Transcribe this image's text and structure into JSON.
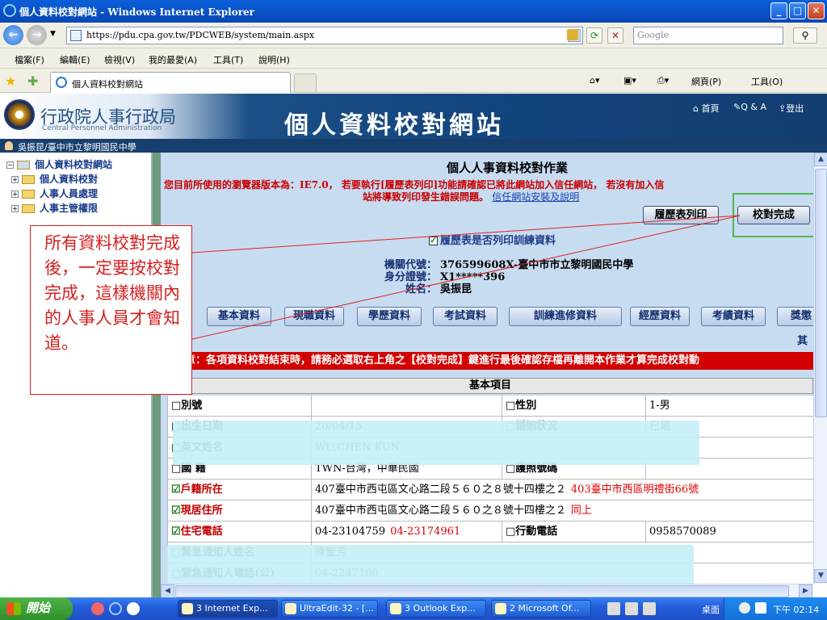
{
  "window": {
    "title": "個人資料校對網站 - Windows Internet Explorer",
    "min": "_",
    "max": "□",
    "close": "✕"
  },
  "address": {
    "url": "https://pdu.cpa.gov.tw/PDCWEB/system/main.aspx",
    "search_placeholder": "Google"
  },
  "menu": [
    "檔案(F)",
    "編輯(E)",
    "檢視(V)",
    "我的最愛(A)",
    "工具(T)",
    "說明(H)"
  ],
  "tab": {
    "label": "個人資料校對網站"
  },
  "commandbar": {
    "page": "網頁(P)",
    "tools": "工具(O)"
  },
  "site": {
    "org_name": "行政院人事行政局",
    "org_name_en": "Central Personnel Administration",
    "title": "個人資料校對網站",
    "links": [
      "首頁",
      "Q & A",
      "登出"
    ],
    "user": "吳振昆/臺中市立黎明國民中學"
  },
  "tree": [
    {
      "label": "個人資料校對網站",
      "sign": "−"
    },
    {
      "label": "個人資料校對",
      "sign": "+"
    },
    {
      "label": "人事人員處理",
      "sign": "+"
    },
    {
      "label": "人事主管權限",
      "sign": "+"
    }
  ],
  "main": {
    "title": "個人人事資料校對作業",
    "warning_line1": "您目前所使用的瀏覽器版本為：IE7.0， 若要執行[履歷表列印]功能請確認已將此網站加入信任網站， 若沒有加入信",
    "warning_line2": "站將導致列印發生錯誤問題。",
    "trust_link": "信任網站安裝及說明",
    "print_button": "履歷表列印",
    "complete_button": "校對完成",
    "checkbox_label": "履歷表是否列印訓練資料",
    "checkbox_mark": "✓",
    "agency_label": "機關代號：",
    "agency_value": "376599608X-臺中市市立黎明國民中學",
    "id_label": "身分證號：",
    "id_value": "X1*****396",
    "name_label": "姓名：",
    "name_value": "吳振昆",
    "tabs": [
      "基本資料",
      "現職資料",
      "學歷資料",
      "考試資料",
      "訓練進修資料",
      "經歷資料",
      "考績資料",
      "獎懲"
    ],
    "other_tab": "其",
    "notice": "※注意：各項資料校對結束時，請務必選取右上角之【校對完成】鍵進行最後確認存檔再離開本作業才算完成校對動",
    "table_title": "基本項目",
    "rows": [
      {
        "l1": "別號",
        "c1": "□",
        "v1": "",
        "l2": "性別",
        "c2": "□",
        "v2": "1-男"
      },
      {
        "l1": "出生日期",
        "c1": "□",
        "v1": "20/04/15",
        "l2": "婚姻狀況",
        "c2": "□",
        "v2": "已婚"
      },
      {
        "l1": "英文姓名",
        "c1": "□",
        "v1": "WU,CHEN KUN",
        "l2": "",
        "c2": "",
        "v2": ""
      },
      {
        "l1": "國 籍",
        "c1": "□",
        "v1": "TWN-台灣，中華民國",
        "l2": "護照號碼",
        "c2": "□",
        "v2": ""
      },
      {
        "l1": "戶籍所在",
        "c1": "☑",
        "v1": "407臺中市西屯區文心路二段５６０之８號十四樓之２",
        "v1red": "403臺中市西區明禮街66號",
        "l2": "",
        "c2": "",
        "v2": ""
      },
      {
        "l1": "現居住所",
        "c1": "☑",
        "v1": "407臺中市西屯區文心路二段５６０之８號十四樓之２",
        "v1red": "同上",
        "l2": "",
        "c2": "",
        "v2": ""
      },
      {
        "l1": "住宅電話",
        "c1": "☑",
        "v1": "04-23104759",
        "v1red": "04-23174961",
        "l2": "行動電話",
        "c2": "□",
        "v2": "0958570089"
      },
      {
        "l1": "緊急通知人姓名",
        "c1": "□",
        "v1": "陳聖芳",
        "l2": "",
        "c2": "",
        "v2": ""
      },
      {
        "l1": "緊急通知人電話(公)",
        "c1": "□",
        "v1": "04-2247100",
        "l2": "",
        "c2": "",
        "v2": ""
      }
    ]
  },
  "annotation": {
    "text": "所有資料校對完成後，一定要按校對完成，這樣機關內的人事人員才會知道。"
  },
  "taskbar": {
    "start": "開始",
    "items": [
      "3 Internet Exp...",
      "UltraEdit-32 - [...",
      "3 Outlook Exp...",
      "2 Microsoft Of..."
    ],
    "desktop": "桌面",
    "clock": "下午 02:14"
  },
  "colors": {
    "accent_red": "#d20000",
    "highlight_green": "#4fb84f",
    "header_blue": "#123e72"
  }
}
